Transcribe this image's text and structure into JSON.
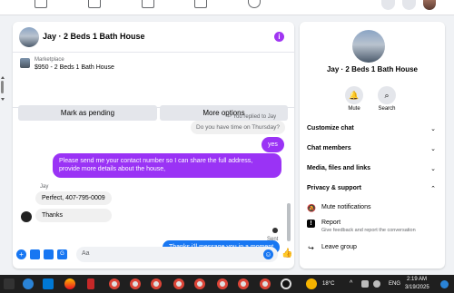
{
  "chat": {
    "title": "Jay · 2 Beds 1 Bath House",
    "info_icon": "info-icon",
    "marketplace": {
      "label": "Marketplace",
      "listing": "$950 - 2 Beds 1 Bath House",
      "mark_pending": "Mark as pending",
      "more_options": "More options"
    },
    "messages": {
      "replied_to": "You replied to Jay",
      "quoted": "Do you have time on Thursday?",
      "yes": "yes",
      "request": "Please send me your contact number so I can share the full address, provide more details about the house,",
      "sender": "Jay",
      "reply1": "Perfect, 407-795-0009",
      "reply2": "Thanks",
      "final": "Thanks i’ll message you in a moment",
      "status": "Sent"
    },
    "composer": {
      "placeholder": "Aa"
    }
  },
  "side": {
    "title": "Jay · 2 Beds 1 Bath House",
    "mute_label": "Mute",
    "search_label": "Search",
    "sections": [
      "Customize chat",
      "Chat members",
      "Media, files and links",
      "Privacy & support"
    ],
    "options": {
      "mute": "Mute notifications",
      "report": "Report",
      "report_sub": "Give feedback and report the conversation",
      "leave": "Leave group"
    }
  },
  "taskbar": {
    "temp": "18°C",
    "lang": "ENG",
    "time": "2:19 AM",
    "date": "3/19/2025"
  },
  "colors": {
    "accent_purple": "#9a33f5",
    "accent_blue": "#1877f2"
  }
}
